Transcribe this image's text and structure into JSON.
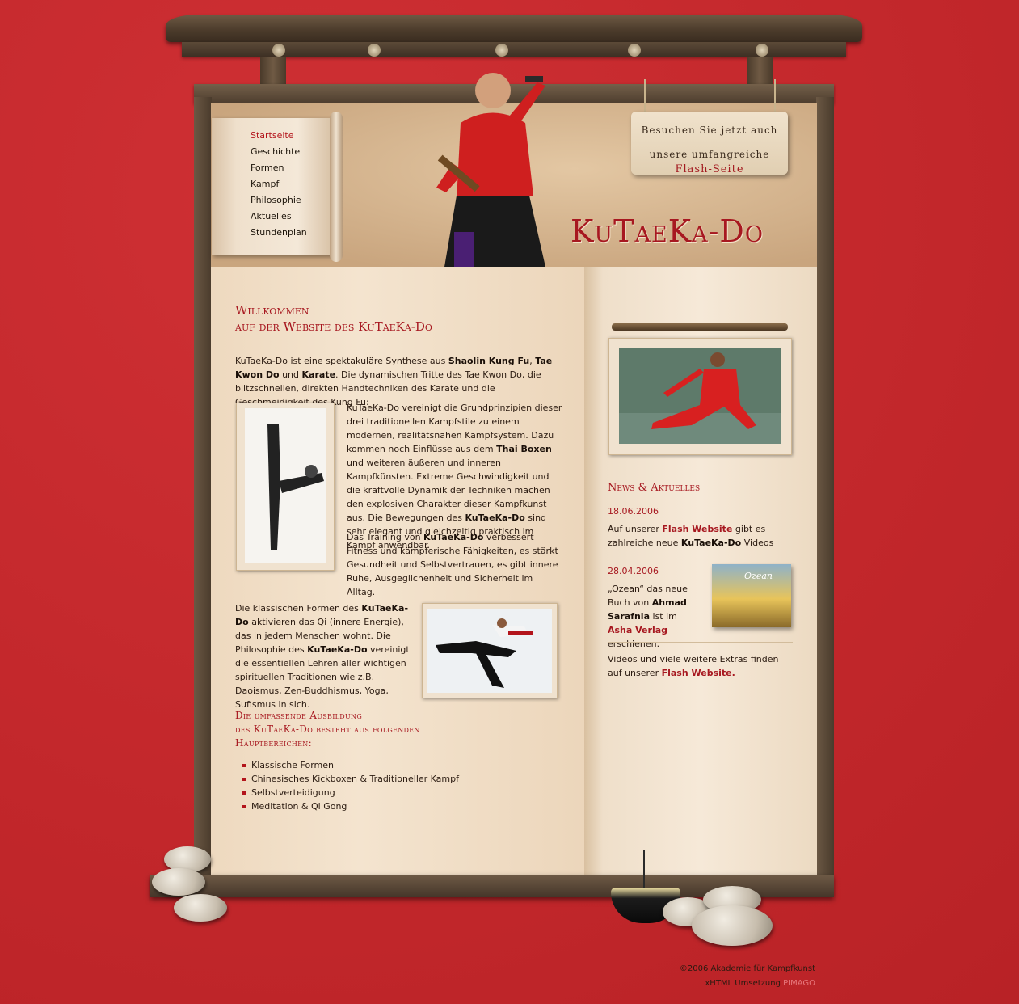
{
  "nav": {
    "items": [
      "Startseite",
      "Geschichte",
      "Formen",
      "Kampf",
      "Philosophie",
      "Aktuelles",
      "Stundenplan"
    ]
  },
  "header": {
    "sign_line1": "Besuchen Sie jetzt auch",
    "sign_line2": "unsere umfangreiche",
    "sign_line3": "Flash-Seite",
    "logo": "KuTaeKa-Do"
  },
  "main": {
    "title_line1": "Willkommen",
    "title_line2": "auf der Website des KuTaeKa-Do",
    "intro_1": "KuTaeKa-Do ist eine spektakuläre Synthese aus ",
    "intro_b1": "Shaolin Kung Fu",
    "intro_2": ", ",
    "intro_b2": "Tae Kwon Do",
    "intro_3": " und ",
    "intro_b3": "Karate",
    "intro_4": ". Die dynamischen Tritte des Tae Kwon Do, die blitzschnellen, direkten Handtechniken des Karate und die Geschmeidigkeit des Kung Fu:",
    "p2_1": "KuTaeKa-Do vereinigt die Grundprinzipien dieser drei traditionellen Kampfstile zu einem modernen, realitätsnahen Kampfsystem. Dazu kommen noch Einflüsse aus dem ",
    "p2_b1": "Thai Boxen",
    "p2_2": " und weiteren äußeren und inneren Kampfkünsten. Extreme Geschwindigkeit und die kraftvolle Dynamik der Techniken machen den explosiven Charakter dieser Kampfkunst aus. Die Bewegungen des ",
    "p2_b2": "KuTaeKa-Do",
    "p2_3": " sind sehr elegant und gleichzeitig praktisch im Kampf anwendbar.",
    "p3_1": "Das Training von ",
    "p3_b1": "KuTaeKa-Do",
    "p3_2": " verbessert Fitness und kämpferische Fähigkeiten, es stärkt Gesundheit und Selbstvertrauen, es gibt innere Ruhe, Ausgeglichenheit und Sicherheit im Alltag.",
    "p4_1": "Die klassischen Formen des ",
    "p4_b1": "KuTaeKa-Do",
    "p4_2": " aktivieren das Qi (innere Energie), das in jedem Menschen wohnt. Die Philosophie des ",
    "p4_b2": "KuTaeKa-Do",
    "p4_3": " vereinigt die essentiellen Lehren aller wichtigen spirituellen Traditionen wie z.B. Daoismus, Zen-Buddhismus, Yoga, Sufismus in sich.",
    "h2_line1": "Die umfassende Ausbildung",
    "h2_line2": "des KuTaeKa-Do besteht aus folgenden",
    "h2_line3": "Hauptbereichen:",
    "list": [
      "Klassische Formen",
      "Chinesisches Kickboxen & Traditioneller Kampf",
      "Selbstverteidigung",
      "Meditation & Qi Gong"
    ]
  },
  "news": {
    "title": "News & Aktuelles",
    "item1_date": "18.06.2006",
    "item1_1": "Auf unserer ",
    "item1_link": "Flash Website",
    "item1_2": " gibt es zahlreiche neue ",
    "item1_b": "KuTaeKa-Do",
    "item1_3": " Videos",
    "item2_date": "28.04.2006",
    "item2_1": "„Ozean“ das neue Buch von ",
    "item2_b": "Ahmad Sarafnia",
    "item2_2": " ist im ",
    "item2_link": "Asha Verlag",
    "item2_3": " erschienen.",
    "book_title": "Ozean",
    "item3_1": "Videos und viele weitere Extras finden auf unserer ",
    "item3_link": "Flash Website."
  },
  "footer": {
    "copyright": "©2006 Akademie für Kampfkunst",
    "credit": "xHTML Umsetzung ",
    "credit_link": "PIMAGO"
  },
  "colors": {
    "background": "#c62a2e",
    "accent": "#a71820",
    "paper": "#f4e4cf",
    "wood": "#4a3a2a"
  }
}
